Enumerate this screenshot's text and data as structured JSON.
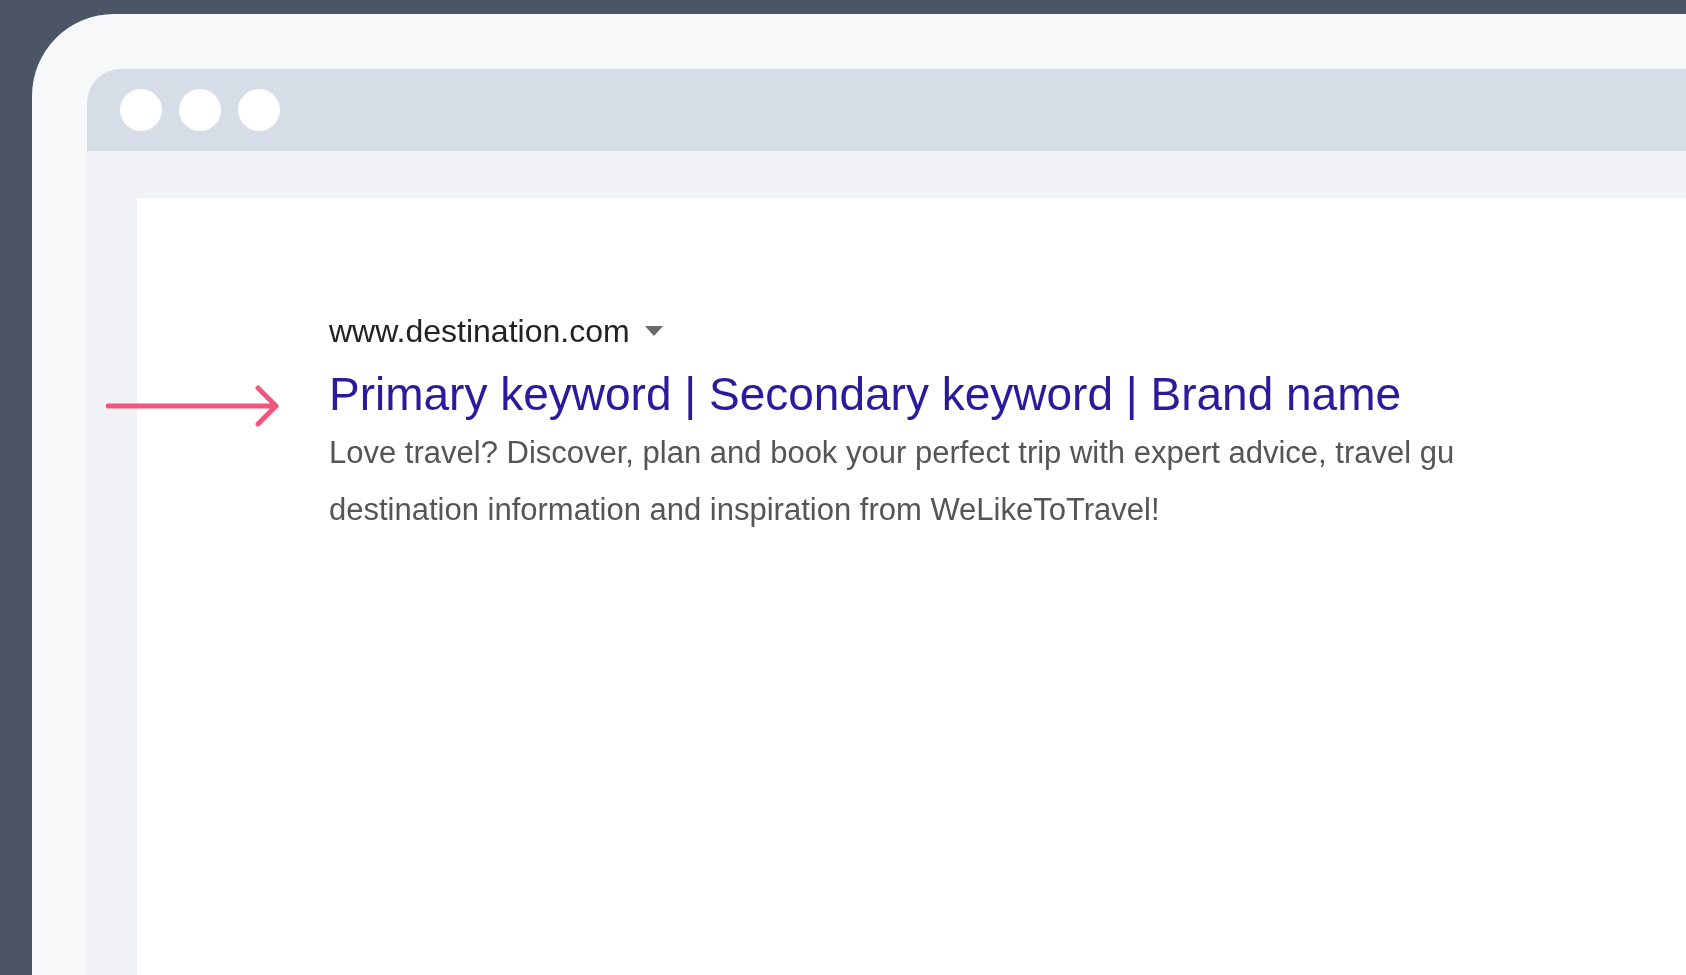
{
  "search_result": {
    "url": "www.destination.com",
    "title": "Primary keyword | Secondary keyword | Brand name",
    "snippet_lines": [
      "Love travel? Discover, plan and book your perfect trip with expert advice, travel gu",
      "destination information and inspiration from WeLikeToTravel!"
    ]
  }
}
